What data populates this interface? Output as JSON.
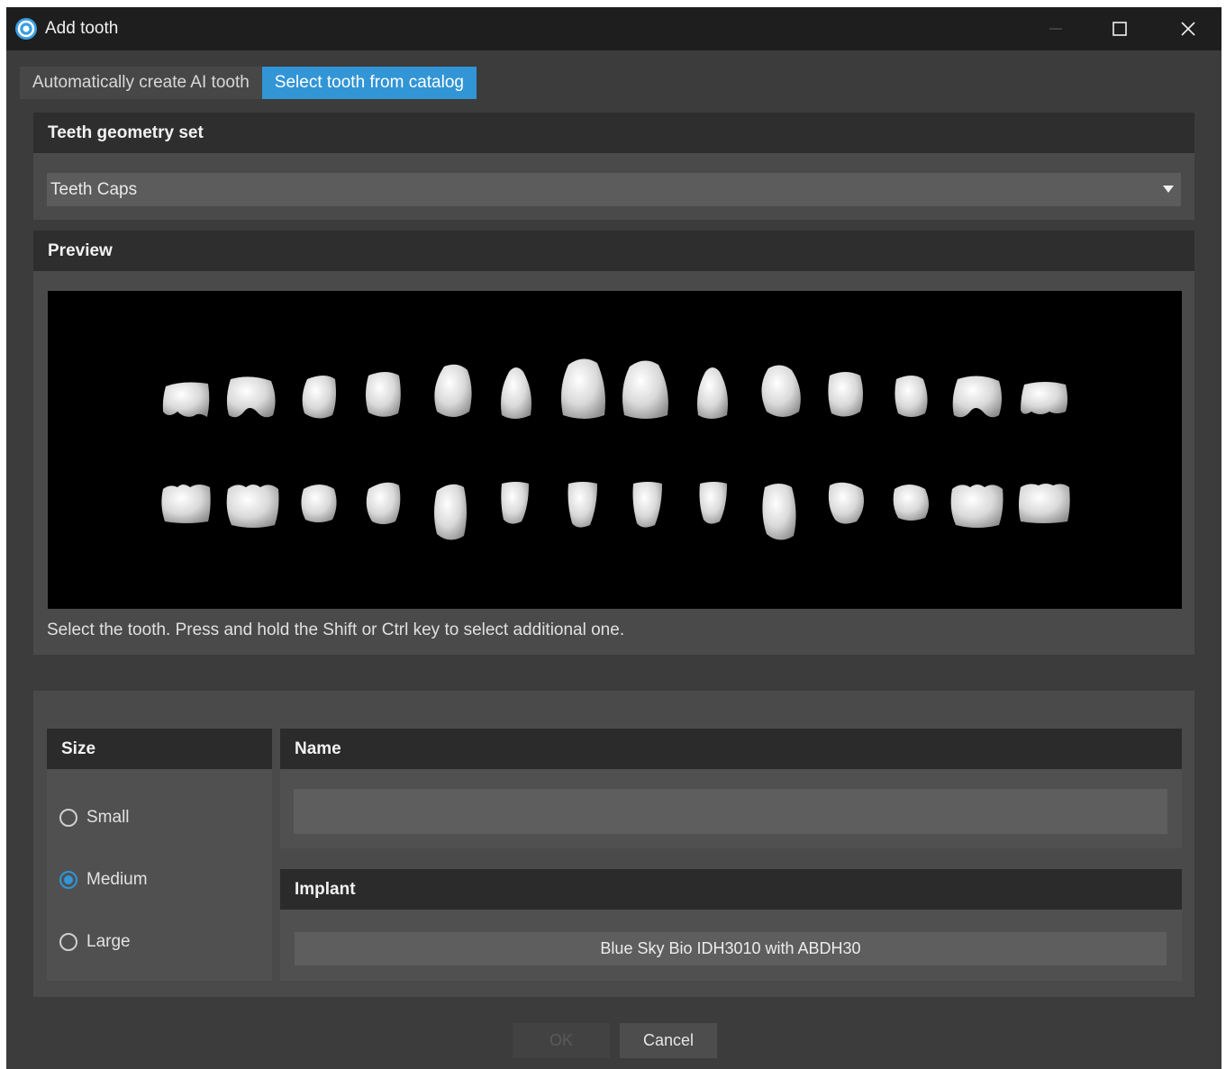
{
  "window": {
    "title": "Add tooth",
    "icons": {
      "app": "app-logo-icon",
      "minimize": "minimize-icon",
      "maximize": "maximize-icon",
      "close": "close-icon"
    }
  },
  "tabs": [
    {
      "label": "Automatically create AI tooth",
      "active": false
    },
    {
      "label": "Select tooth from catalog",
      "active": true
    }
  ],
  "geometry": {
    "header": "Teeth geometry set",
    "selected": "Teeth Caps"
  },
  "preview": {
    "header": "Preview",
    "hint": "Select the tooth. Press and hold the Shift or Ctrl key to select additional one.",
    "upper_count": 14,
    "lower_count": 14
  },
  "size": {
    "header": "Size",
    "options": [
      {
        "label": "Small",
        "checked": false
      },
      {
        "label": "Medium",
        "checked": true
      },
      {
        "label": "Large",
        "checked": false
      }
    ]
  },
  "name": {
    "header": "Name",
    "value": ""
  },
  "implant": {
    "header": "Implant",
    "value": "Blue Sky Bio IDH3010 with ABDH30"
  },
  "buttons": {
    "ok": "OK",
    "cancel": "Cancel"
  },
  "colors": {
    "accent": "#3195d6",
    "window_bg": "#3c3c3c",
    "titlebar": "#1e1e1e",
    "tooth": "#e8e8e8"
  }
}
